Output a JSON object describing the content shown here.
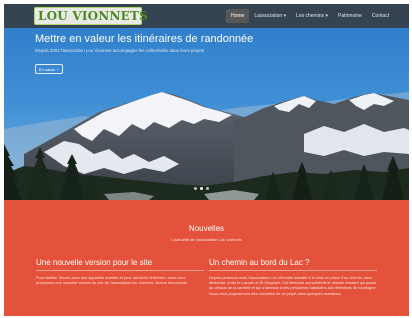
{
  "navbar": {
    "logo_text": "LOU VIONNETS",
    "items": [
      {
        "label": "Home",
        "active": true
      },
      {
        "label": "Lassociation ▾",
        "active": false
      },
      {
        "label": "Les chemins ▾",
        "active": false
      },
      {
        "label": "Patrimoine",
        "active": false
      },
      {
        "label": "Contact",
        "active": false
      }
    ]
  },
  "hero": {
    "title": "Mettre en valeur les itinéraires de randonnée",
    "subtitle": "Depuis 2003 l'association Lou Vionnets accompagne les collectivités dans leurs projets",
    "button_label": "En savoir +",
    "carousel": {
      "slides": 3,
      "active_slide": 2
    }
  },
  "news": {
    "heading": "Nouvelles",
    "subheading": "L'actualité de l'association Lou Vionnets",
    "cards": [
      {
        "title": "Une nouvelle version pour le site",
        "body": "Pour faciliter l'accès avec des appareils mobiles et pour rafraichir l'interface, nous vous proposons une nouvelle version du site de l'association lou Vionnets. Bonne découverte"
      },
      {
        "title": "Un chemin au bord du Lac ?",
        "body": "Depuis plusieurs mois l'association Lou Vionnets travaille à la mise en place d'un chemin, sans désherbé, entre le Lazurin et St Gingolph. Cet itinéraire compléterait le chemin existant qui passe au dessus de la carrière et qui s'adresse à des personnes habituées aux itinéraires de montagne. Nous vous proposerons des nouvelles de ce projet dans quelques semaines."
      }
    ]
  },
  "colors": {
    "accent": "#e4523b",
    "navbar": "#373737",
    "logo_green": "#4d8a23"
  }
}
